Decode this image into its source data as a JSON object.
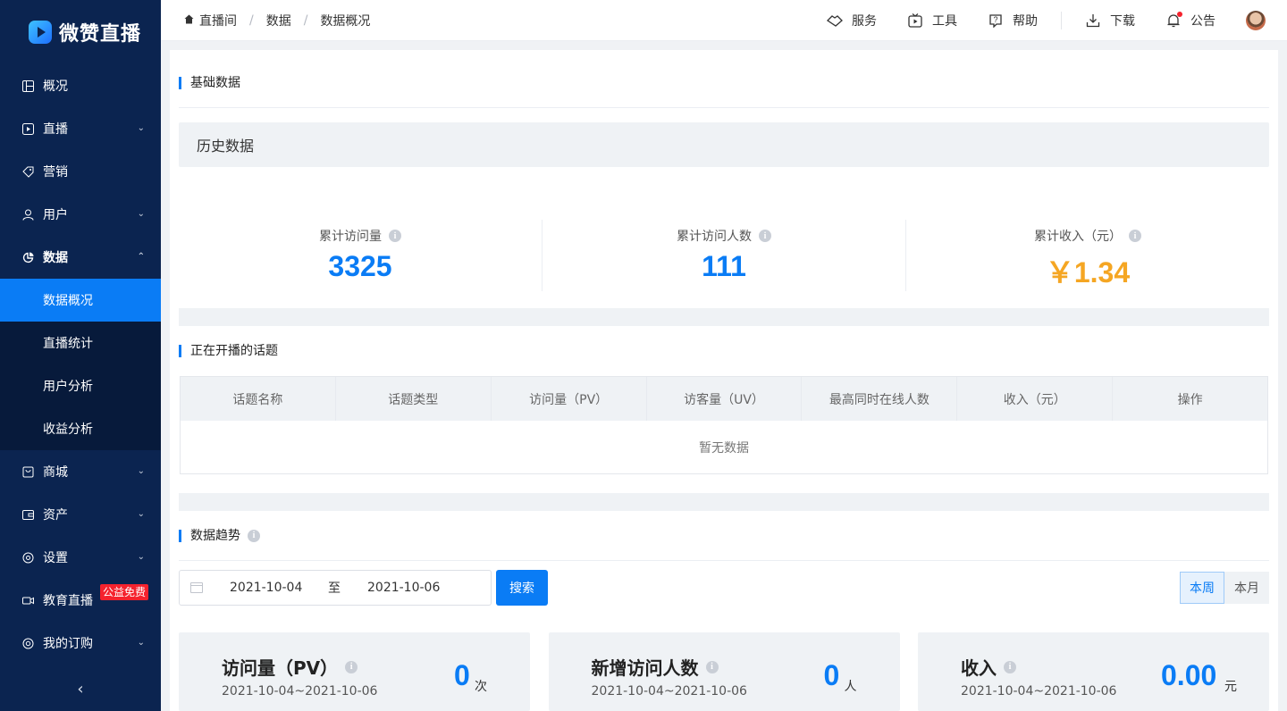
{
  "app": {
    "name": "微赞直播"
  },
  "sidebar": {
    "items": [
      {
        "label": "概况",
        "icon": "dashboard-icon"
      },
      {
        "label": "直播",
        "icon": "play-icon"
      },
      {
        "label": "营销",
        "icon": "tag-icon"
      },
      {
        "label": "用户",
        "icon": "user-icon"
      },
      {
        "label": "数据",
        "icon": "pie-chart-icon"
      },
      {
        "label": "商城",
        "icon": "bag-icon"
      },
      {
        "label": "资产",
        "icon": "wallet-icon"
      },
      {
        "label": "设置",
        "icon": "gear-icon"
      },
      {
        "label": "教育直播",
        "icon": "camera-icon",
        "badge": "公益免费"
      },
      {
        "label": "我的订购",
        "icon": "order-icon"
      }
    ],
    "data_submenu": [
      "数据概况",
      "直播统计",
      "用户分析",
      "收益分析"
    ],
    "collapse": "‹"
  },
  "breadcrumb": [
    "直播间",
    "数据",
    "数据概况"
  ],
  "header_actions": [
    {
      "label": "服务",
      "icon": "handshake-icon"
    },
    {
      "label": "工具",
      "icon": "tv-icon"
    },
    {
      "label": "帮助",
      "icon": "help-icon"
    },
    {
      "label": "下载",
      "icon": "download-icon"
    },
    {
      "label": "公告",
      "icon": "bell-icon"
    }
  ],
  "basic": {
    "title": "基础数据",
    "history_label": "历史数据",
    "stats": [
      {
        "label": "累计访问量",
        "value": "3325"
      },
      {
        "label": "累计访问人数",
        "value": "111"
      },
      {
        "label": "累计收入（元）",
        "value": "￥1.34"
      }
    ]
  },
  "topics": {
    "title": "正在开播的话题",
    "columns": [
      "话题名称",
      "话题类型",
      "访问量（PV）",
      "访客量（UV）",
      "最高同时在线人数",
      "收入（元）",
      "操作"
    ],
    "empty_text": "暂无数据"
  },
  "trend": {
    "title": "数据趋势",
    "date_from": "2021-10-04",
    "date_to_label": "至",
    "date_to": "2021-10-06",
    "search_label": "搜索",
    "ranges": [
      "本周",
      "本月"
    ],
    "selected_range": "本周",
    "cards": [
      {
        "title": "访问量（PV）",
        "range": "2021-10-04~2021-10-06",
        "value": "0",
        "unit": "次"
      },
      {
        "title": "新增访问人数",
        "range": "2021-10-04~2021-10-06",
        "value": "0",
        "unit": "人"
      },
      {
        "title": "收入",
        "range": "2021-10-04~2021-10-06",
        "value": "0.00",
        "unit": "元"
      }
    ]
  },
  "colors": {
    "primary": "#0a7cf5",
    "sidebar_bg": "#0b2450",
    "income": "#f5a623",
    "badge": "#f5222d"
  }
}
